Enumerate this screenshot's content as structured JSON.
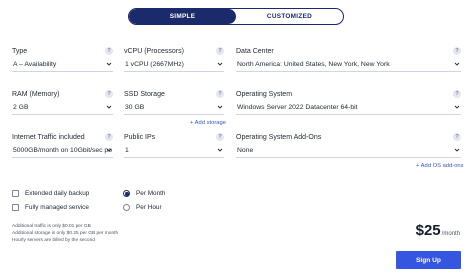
{
  "plan_toggle": {
    "simple": "SIMPLE",
    "customized": "CUSTOMIZED",
    "selected": "SIMPLE"
  },
  "fields": {
    "type": {
      "label": "Type",
      "value": "A – Availability"
    },
    "vcpu": {
      "label": "vCPU (Processors)",
      "value": "1 vCPU (2667MHz)"
    },
    "datacenter": {
      "label": "Data Center",
      "value": "North America: United States, New York, New York"
    },
    "ram": {
      "label": "RAM (Memory)",
      "value": "2 GB"
    },
    "ssd": {
      "label": "SSD Storage",
      "value": "30 GB"
    },
    "os": {
      "label": "Operating System",
      "value": "Windows Server 2022 Datacenter 64-bit"
    },
    "traffic": {
      "label": "Internet Traffic included",
      "value": "5000GB/month on 10Gbit/sec po"
    },
    "ips": {
      "label": "Public IPs",
      "value": "1"
    },
    "os_addons": {
      "label": "Operating System Add-Ons",
      "value": "None"
    }
  },
  "links": {
    "add_storage": "+ Add storage",
    "add_os_addons": "+ Add OS add-ons"
  },
  "options": {
    "backup": {
      "label": "Extended daily backup",
      "checked": false
    },
    "managed": {
      "label": "Fully managed service",
      "checked": false
    },
    "per_month": {
      "label": "Per Month",
      "selected": true
    },
    "per_hour": {
      "label": "Per Hour",
      "selected": false
    }
  },
  "notes": [
    "Additional traffic is only $0.01 per GB",
    "Additional storage is only $0.25 per GB per month",
    "Hourly servers are billed by the second"
  ],
  "price": {
    "amount": "$25",
    "period": "/month"
  },
  "signup_label": "Sign Up",
  "help_icon_glyph": "?",
  "colors": {
    "accent": "#1a2a6b",
    "button": "#3456e0"
  }
}
